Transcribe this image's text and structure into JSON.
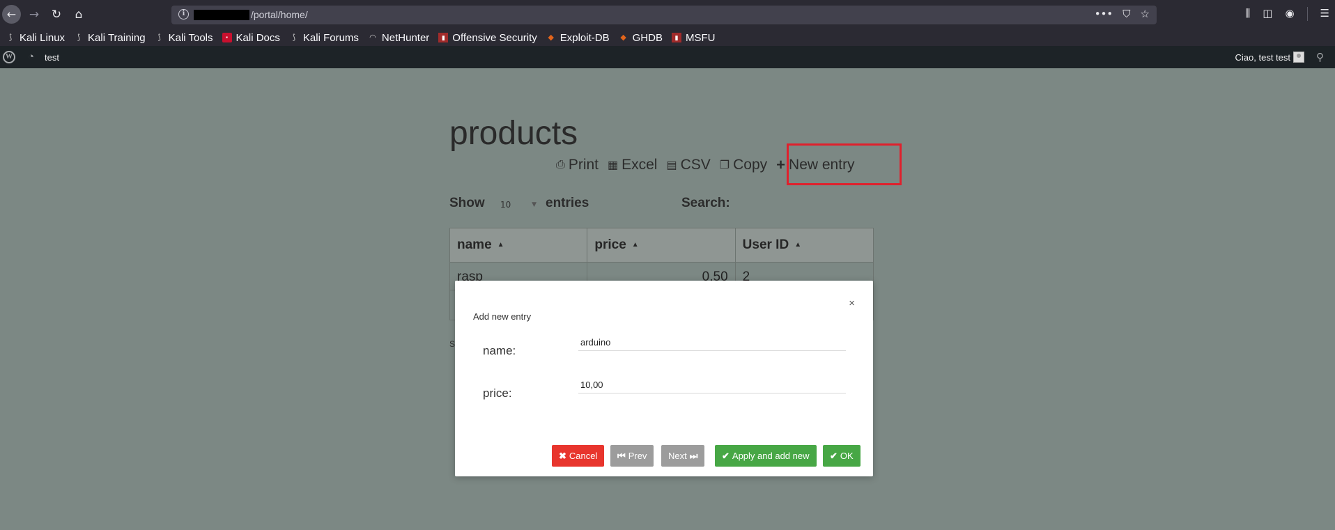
{
  "browser": {
    "url_path": "/portal/home/",
    "bookmarks": [
      {
        "label": "Kali Linux",
        "icon": "kali-dragon-icon"
      },
      {
        "label": "Kali Training",
        "icon": "kali-dragon-icon"
      },
      {
        "label": "Kali Tools",
        "icon": "kali-dragon-icon"
      },
      {
        "label": "Kali Docs",
        "icon": "kali-docs-icon"
      },
      {
        "label": "Kali Forums",
        "icon": "kali-dragon-icon"
      },
      {
        "label": "NetHunter",
        "icon": "nethunter-icon"
      },
      {
        "label": "Offensive Security",
        "icon": "offsec-icon"
      },
      {
        "label": "Exploit-DB",
        "icon": "exploitdb-icon"
      },
      {
        "label": "GHDB",
        "icon": "ghdb-icon"
      },
      {
        "label": "MSFU",
        "icon": "msfu-icon"
      }
    ]
  },
  "adminbar": {
    "site_name": "test",
    "greeting": "Ciao, test test"
  },
  "page": {
    "title": "products",
    "buttons": {
      "print": "Print",
      "excel": "Excel",
      "csv": "CSV",
      "copy": "Copy",
      "new_entry": "New entry"
    },
    "show_label": "Show",
    "show_value": "10",
    "entries_label": "entries",
    "search_label": "Search:",
    "highlight_color": "#e0202c"
  },
  "table": {
    "columns": [
      "name",
      "price",
      "User ID"
    ],
    "rows": [
      {
        "name": "rasp",
        "price": "0.50",
        "user_id": "2"
      }
    ],
    "info_fragment": "Sh"
  },
  "modal": {
    "title": "Add new entry",
    "close_glyph": "×",
    "fields": {
      "name_label": "name:",
      "name_value": "arduino",
      "price_label": "price:",
      "price_value": "10,00"
    },
    "buttons": {
      "cancel": "Cancel",
      "prev": "Prev",
      "next": "Next",
      "apply": "Apply and add new",
      "ok": "OK"
    },
    "colors": {
      "cancel": "#e8352d",
      "nav": "#9c9c9c",
      "confirm": "#47a745"
    }
  }
}
